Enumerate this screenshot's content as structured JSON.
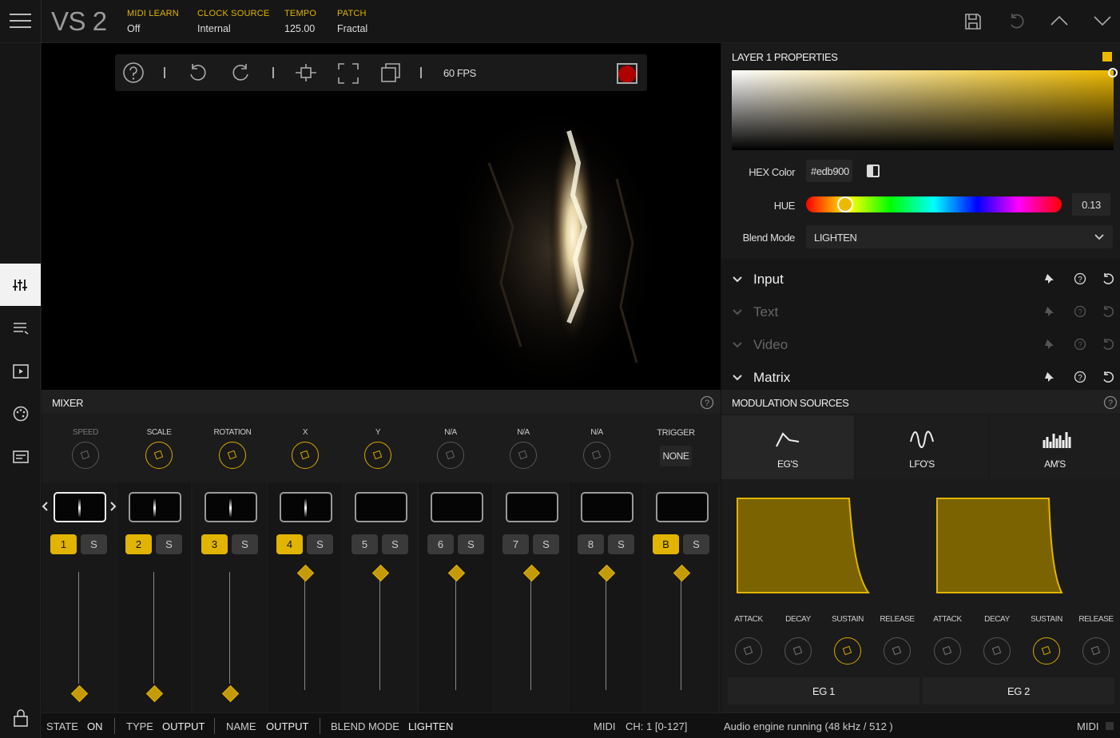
{
  "app": {
    "logo": "VS 2"
  },
  "header": {
    "items": [
      {
        "label": "MIDI LEARN",
        "value": "Off"
      },
      {
        "label": "CLOCK SOURCE",
        "value": "Internal"
      },
      {
        "label": "TEMPO",
        "value": "125.00"
      },
      {
        "label": "PATCH",
        "value": "Fractal"
      }
    ]
  },
  "viewport": {
    "fps": "60 FPS"
  },
  "layer": {
    "title": "LAYER 1 PROPERTIES",
    "hex_label": "HEX Color",
    "hex_value": "#edb900",
    "hue_label": "HUE",
    "hue_value": "0.13",
    "blend_label": "Blend Mode",
    "blend_value": "LIGHTEN",
    "sections": [
      {
        "label": "Input",
        "enabled": true
      },
      {
        "label": "Text",
        "enabled": false
      },
      {
        "label": "Video",
        "enabled": false
      },
      {
        "label": "Matrix",
        "enabled": true
      }
    ]
  },
  "mixer": {
    "title": "MIXER",
    "params": [
      "SPEED",
      "SCALE",
      "ROTATION",
      "X",
      "Y",
      "N/A",
      "N/A",
      "N/A"
    ],
    "trigger_label": "TRIGGER",
    "trigger_value": "NONE",
    "channels": [
      "1",
      "2",
      "3",
      "4",
      "5",
      "6",
      "7",
      "8",
      "B"
    ],
    "solo": "S"
  },
  "modulation": {
    "title": "MODULATION SOURCES",
    "tabs": [
      "EG'S",
      "LFO'S",
      "AM'S"
    ],
    "eg_params": [
      "ATTACK",
      "DECAY",
      "SUSTAIN",
      "RELEASE",
      "ATTACK",
      "DECAY",
      "SUSTAIN",
      "RELEASE"
    ],
    "eg_names": [
      "EG 1",
      "EG 2"
    ]
  },
  "status": {
    "state_label": "STATE",
    "state_value": "ON",
    "type_label": "TYPE",
    "type_value": "OUTPUT",
    "name_label": "NAME",
    "name_value": "OUTPUT",
    "blend_label": "BLEND MODE",
    "blend_value": "LIGHTEN",
    "midi": "MIDI",
    "ch": "CH: 1  [0-127]",
    "audio": "Audio engine running (48 kHz / 512 )",
    "midi2": "MIDI"
  },
  "colors": {
    "accent": "#e0b400",
    "record": "#c00000"
  }
}
